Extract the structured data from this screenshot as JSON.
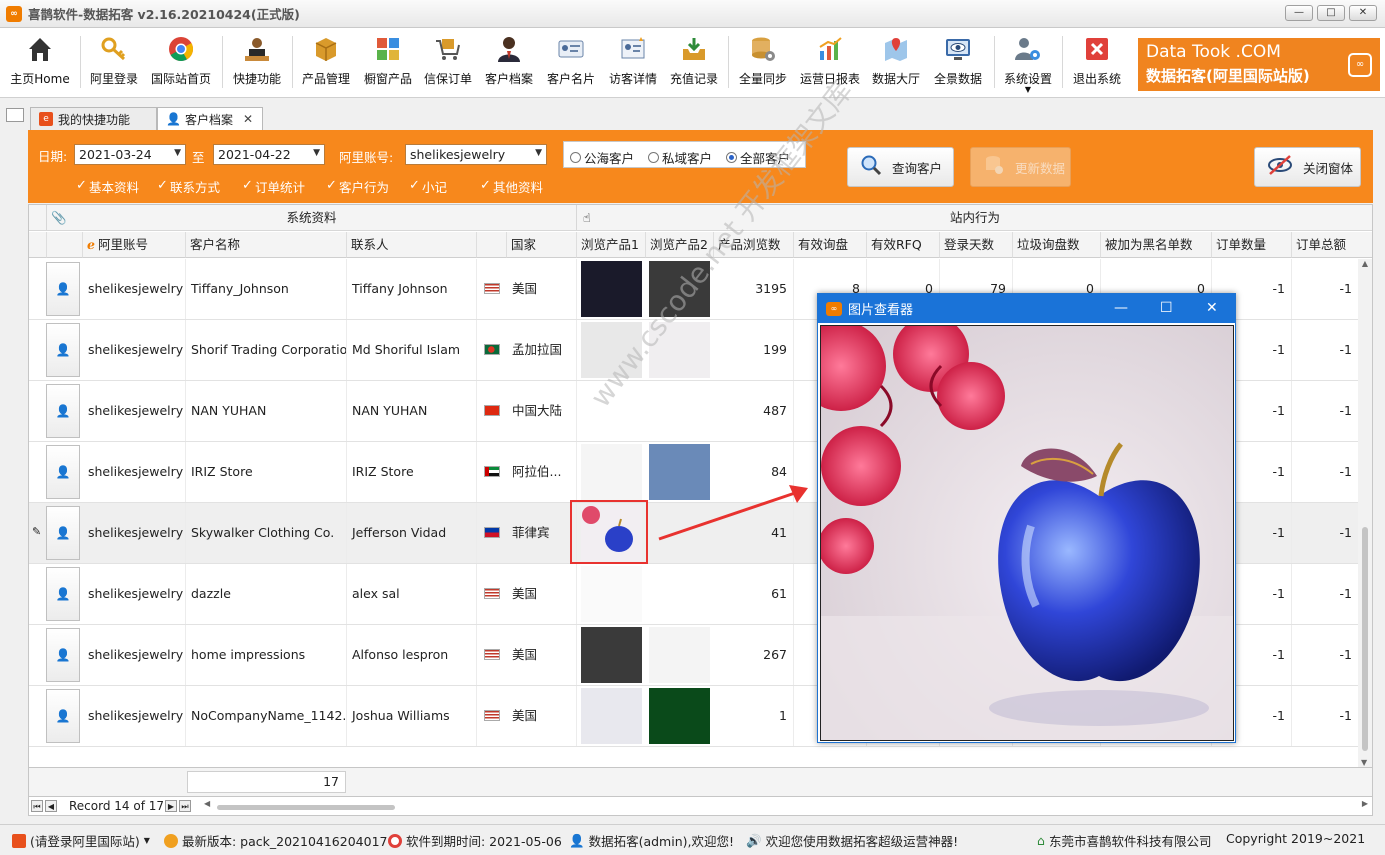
{
  "window": {
    "title": "喜鹊软件-数据拓客 v2.16.20210424(正式版)",
    "minimize_label": "—",
    "maximize_label": "□",
    "close_label": "✕"
  },
  "toolbar": {
    "items": [
      {
        "label": "主页Home",
        "icon": "home-icon"
      },
      {
        "label": "阿里登录",
        "icon": "key-icon"
      },
      {
        "label": "国际站首页",
        "icon": "chrome-icon"
      },
      {
        "label": "快捷功能",
        "icon": "person-desk-icon"
      },
      {
        "label": "产品管理",
        "icon": "box-icon"
      },
      {
        "label": "橱窗产品",
        "icon": "showcase-icon"
      },
      {
        "label": "信保订单",
        "icon": "cart-icon"
      },
      {
        "label": "客户档案",
        "icon": "customer-icon"
      },
      {
        "label": "客户名片",
        "icon": "business-card-icon"
      },
      {
        "label": "访客详情",
        "icon": "visitor-icon"
      },
      {
        "label": "充值记录",
        "icon": "inbox-icon"
      },
      {
        "label": "全量同步",
        "icon": "database-gear-icon"
      },
      {
        "label": "运营日报表",
        "icon": "chart-icon"
      },
      {
        "label": "数据大厅",
        "icon": "map-pin-icon"
      },
      {
        "label": "全景数据",
        "icon": "monitor-eye-icon"
      },
      {
        "label": "系统设置",
        "icon": "users-gear-icon"
      },
      {
        "label": "退出系统",
        "icon": "exit-icon"
      }
    ],
    "brand": {
      "line1": "Data Took .COM",
      "line2": "数据拓客(阿里国际站版)"
    }
  },
  "tabs": [
    {
      "label": "我的快捷功能",
      "active": false
    },
    {
      "label": "客户档案",
      "active": true
    }
  ],
  "filter": {
    "date_label": "日期:",
    "date_from": "2021-03-24",
    "date_sep": "至",
    "date_to": "2021-04-22",
    "account_label": "阿里账号:",
    "account_value": "shelikesjewelry",
    "radios": [
      {
        "label": "公海客户",
        "checked": false
      },
      {
        "label": "私域客户",
        "checked": false
      },
      {
        "label": "全部客户",
        "checked": true
      }
    ],
    "checks": [
      "基本资料",
      "联系方式",
      "订单统计",
      "客户行为",
      "小记",
      "其他资料"
    ],
    "query_button": "查询客户",
    "update_button": "更新数据",
    "close_button": "关闭窗体"
  },
  "grid": {
    "band_left": "系统资料",
    "band_right": "站内行为",
    "columns": [
      "阿里账号",
      "客户名称",
      "联系人",
      "国家",
      "浏览产品1",
      "浏览产品2",
      "产品浏览数",
      "有效询盘",
      "有效RFQ",
      "登录天数",
      "垃圾询盘数",
      "被加为黑名单数",
      "订单数量",
      "订单总额"
    ],
    "rows": [
      {
        "account": "shelikesjewelry",
        "name": "Tiffany_Johnson",
        "contact": "Tiffany Johnson",
        "country": "美国",
        "flag": "us",
        "views": "3195",
        "inquiries": "8",
        "rfq": "0",
        "login_days": "79",
        "spam": "0",
        "blacklist": "0",
        "orders": "-1",
        "order_total": "-1"
      },
      {
        "account": "shelikesjewelry",
        "name": "Shorif Trading Corporation",
        "contact": "Md Shoriful Islam",
        "country": "孟加拉国",
        "flag": "bd",
        "views": "199",
        "inquiries": "",
        "rfq": "",
        "login_days": "",
        "spam": "",
        "blacklist": "",
        "orders": "-1",
        "order_total": "-1"
      },
      {
        "account": "shelikesjewelry",
        "name": "NAN YUHAN",
        "contact": "NAN YUHAN",
        "country": "中国大陆",
        "flag": "cn",
        "views": "487",
        "inquiries": "",
        "rfq": "",
        "login_days": "",
        "spam": "",
        "blacklist": "",
        "orders": "-1",
        "order_total": "-1"
      },
      {
        "account": "shelikesjewelry",
        "name": "IRIZ Store",
        "contact": "IRIZ Store",
        "country": "阿拉伯...",
        "flag": "ae",
        "views": "84",
        "inquiries": "",
        "rfq": "",
        "login_days": "",
        "spam": "",
        "blacklist": "",
        "orders": "-1",
        "order_total": "-1"
      },
      {
        "account": "shelikesjewelry",
        "name": "Skywalker Clothing Co.",
        "contact": "Jefferson Vidad",
        "country": "菲律宾",
        "flag": "ph",
        "views": "41",
        "inquiries": "",
        "rfq": "",
        "login_days": "",
        "spam": "",
        "blacklist": "",
        "orders": "-1",
        "order_total": "-1"
      },
      {
        "account": "shelikesjewelry",
        "name": "dazzle",
        "contact": "alex sal",
        "country": "美国",
        "flag": "us",
        "views": "61",
        "inquiries": "",
        "rfq": "",
        "login_days": "",
        "spam": "",
        "blacklist": "",
        "orders": "-1",
        "order_total": "-1"
      },
      {
        "account": "shelikesjewelry",
        "name": "home impressions",
        "contact": "Alfonso lespron",
        "country": "美国",
        "flag": "us",
        "views": "267",
        "inquiries": "",
        "rfq": "",
        "login_days": "",
        "spam": "",
        "blacklist": "",
        "orders": "-1",
        "order_total": "-1"
      },
      {
        "account": "shelikesjewelry",
        "name": "NoCompanyName_1142...",
        "contact": "Joshua Williams",
        "country": "美国",
        "flag": "us",
        "views": "1",
        "inquiries": "",
        "rfq": "",
        "login_days": "",
        "spam": "",
        "blacklist": "",
        "orders": "-1",
        "order_total": "-1"
      }
    ],
    "summary_value": "17",
    "record_text": "Record 14 of 17"
  },
  "viewer": {
    "title": "图片查看器",
    "minimize_label": "—",
    "maximize_label": "☐",
    "close_label": "✕"
  },
  "statusbar": {
    "login": "(请登录阿里国际站)",
    "version": "最新版本: pack_20210416204017",
    "expiry": "软件到期时间: 2021-05-06",
    "user": "数据拓客(admin),欢迎您!",
    "welcome": "欢迎您使用数据拓客超级运营神器!",
    "company": "东莞市喜鹊软件科技有限公司",
    "copyright": "Copyright 2019~2021"
  },
  "watermark": "www.cscode.net 开发框架文库",
  "colors": {
    "accent_orange": "#f7881c",
    "viewer_blue": "#1a73d8",
    "highlight_red": "#e8322f"
  }
}
